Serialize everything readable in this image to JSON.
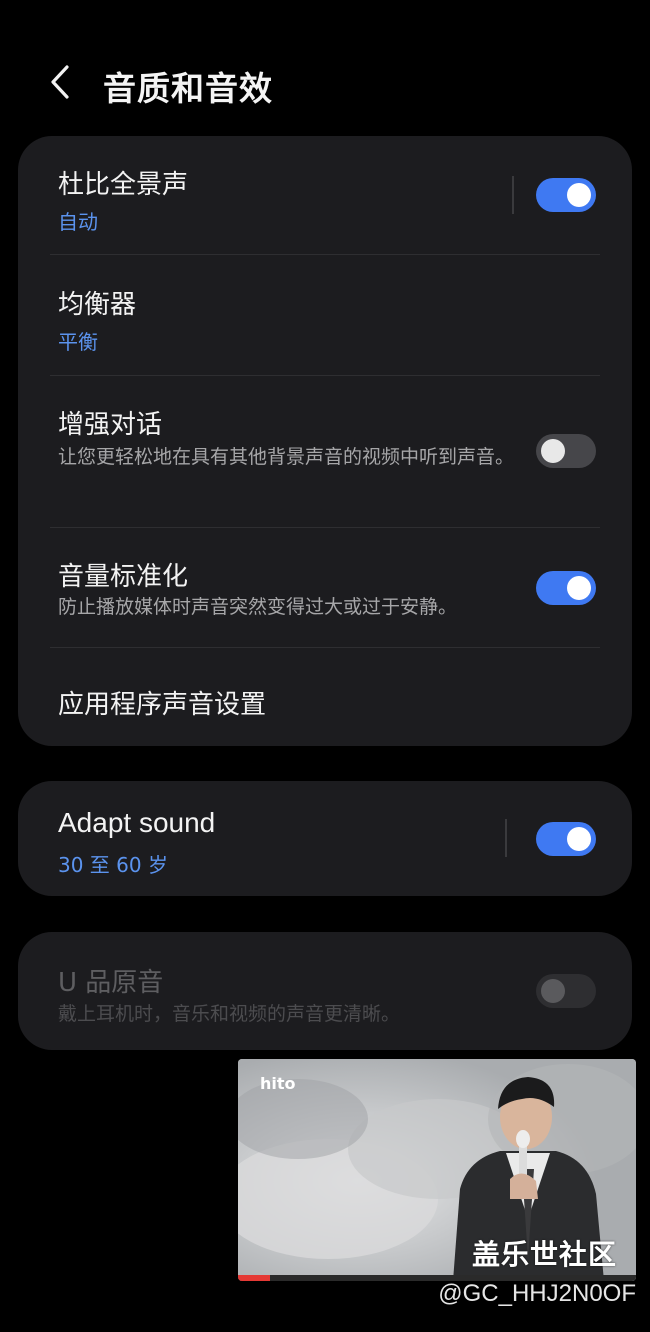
{
  "header": {
    "title": "音质和音效"
  },
  "card1": {
    "items": [
      {
        "title": "杜比全景声",
        "subtitle": "自动",
        "toggle": "on"
      },
      {
        "title": "均衡器",
        "subtitle": "平衡"
      },
      {
        "title": "增强对话",
        "description": "让您更轻松地在具有其他背景声音的视频中听到声音。",
        "toggle": "off"
      },
      {
        "title": "音量标准化",
        "description": "防止播放媒体时声音突然变得过大或过于安静。",
        "toggle": "on"
      },
      {
        "title": "应用程序声音设置"
      }
    ]
  },
  "card2": {
    "title": "Adapt sound",
    "subtitle": "30 至 60 岁",
    "toggle": "on"
  },
  "card3": {
    "title": "U 品原音",
    "description": "戴上耳机时，音乐和视频的声音更清晰。",
    "toggle": "off",
    "disabled": true
  },
  "pip": {
    "logo_text": "hito",
    "playback_progress": 0.08
  },
  "watermark": {
    "site": "盖乐世社区",
    "user": "@GC_HHJ2N0OF"
  },
  "colors": {
    "accent": "#3f79f2",
    "subtitle_blue": "#5b93ee",
    "card_bg": "#1c1c1f",
    "page_bg": "#000000"
  }
}
